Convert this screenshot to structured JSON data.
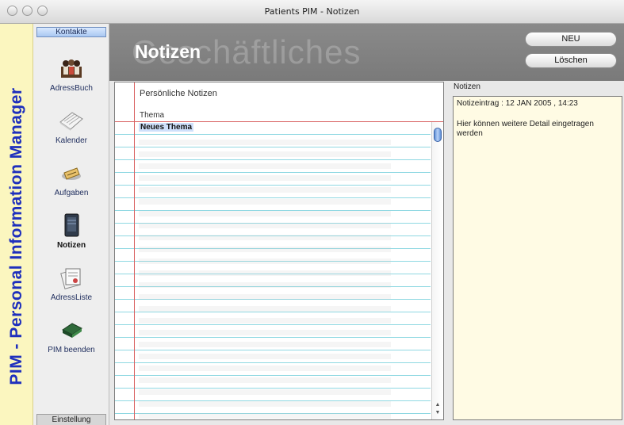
{
  "window": {
    "title": "Patients PIM - Notizen"
  },
  "banner": {
    "text": "PIM - Personal Information Manager"
  },
  "sidebar": {
    "top_tab": "Kontakte",
    "items": [
      {
        "label": "AdressBuch",
        "icon": "address-book-icon"
      },
      {
        "label": "Kalender",
        "icon": "calendar-icon"
      },
      {
        "label": "Aufgaben",
        "icon": "tasks-icon"
      },
      {
        "label": "Notizen",
        "icon": "notes-icon",
        "active": true
      },
      {
        "label": "AdressListe",
        "icon": "address-list-icon"
      },
      {
        "label": "PIM beenden",
        "icon": "quit-book-icon"
      }
    ],
    "bottom_tab": "Einstellung"
  },
  "header": {
    "watermark": "Geschäftliches",
    "title": "Notizen",
    "buttons": {
      "new": "NEU",
      "delete": "Löschen"
    }
  },
  "notebook": {
    "heading": "Persönliche Notizen",
    "topic_label": "Thema",
    "topics": [
      "Neues Thema"
    ]
  },
  "notes": {
    "title": "Notizen",
    "entry_header": "Notizeintrag : 12 JAN 2005 , 14:23",
    "entry_body": "Hier können weitere Detail eingetragen werden"
  },
  "colors": {
    "banner_bg": "#fbf6bf",
    "banner_text": "#1e2fbd",
    "header_bg": "#808080",
    "notes_bg": "#fffbe4",
    "line_blue": "#8fd8e2",
    "margin_red": "#d96060"
  }
}
